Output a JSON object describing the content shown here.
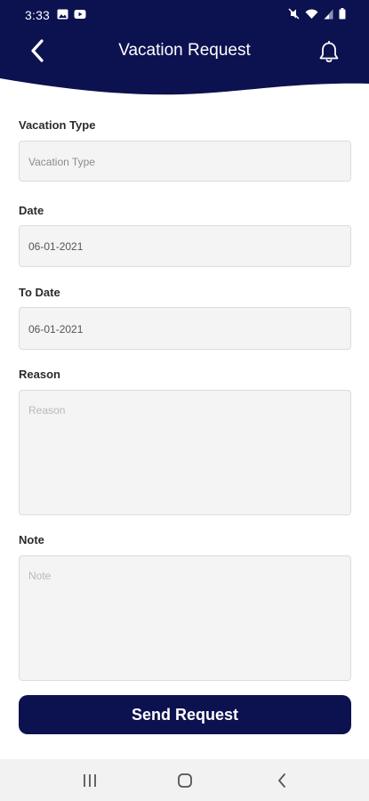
{
  "status_bar": {
    "time": "3:33",
    "left_icons": [
      "gallery-icon",
      "youtube-icon"
    ],
    "right_icons": [
      "mute-icon",
      "wifi-icon",
      "signal-icon",
      "battery-icon"
    ]
  },
  "header": {
    "title": "Vacation Request",
    "background_color": "#0c1150",
    "back_icon": "chevron-left-icon",
    "notification_icon": "bell-icon"
  },
  "form": {
    "vacation_type": {
      "label": "Vacation Type",
      "placeholder": "Vacation Type",
      "value": ""
    },
    "date": {
      "label": "Date",
      "value": "06-01-2021"
    },
    "to_date": {
      "label": "To Date",
      "value": "06-01-2021"
    },
    "reason": {
      "label": "Reason",
      "placeholder": "Reason",
      "value": ""
    },
    "note": {
      "label": "Note",
      "placeholder": "Note",
      "value": ""
    }
  },
  "actions": {
    "send_label": "Send Request",
    "send_color": "#0c1150"
  },
  "nav_bar": {
    "buttons": [
      "recent-apps-icon",
      "home-icon",
      "back-icon"
    ]
  }
}
